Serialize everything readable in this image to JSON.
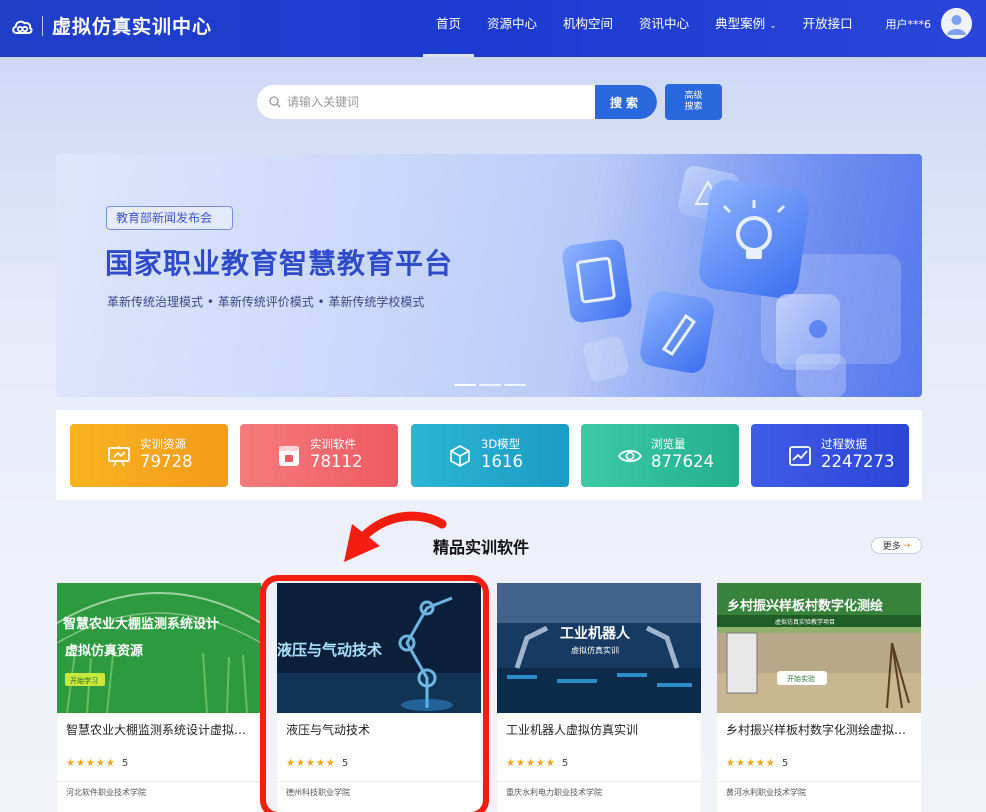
{
  "header": {
    "logo_text": "虚拟仿真实训中心",
    "nav": [
      {
        "label": "首页",
        "active": true
      },
      {
        "label": "资源中心"
      },
      {
        "label": "机构空间"
      },
      {
        "label": "资讯中心"
      },
      {
        "label": "典型案例",
        "dropdown": true
      },
      {
        "label": "开放接口"
      }
    ],
    "user_name": "用户***6"
  },
  "search": {
    "placeholder": "请输入关键词",
    "button": "搜索",
    "advanced_line1": "高级",
    "advanced_line2": "搜索"
  },
  "banner": {
    "tag": "教育部新闻发布会",
    "title": "国家职业教育智慧教育平台",
    "subtitle": "革新传统治理模式 • 革新传统评价模式 • 革新传统学校模式",
    "slides": 3,
    "active_slide": 0
  },
  "stats": [
    {
      "label": "实训资源",
      "value": "79728",
      "icon": "presentation-icon",
      "color_from": "#f7b21f",
      "color_to": "#f59a1a"
    },
    {
      "label": "实训软件",
      "value": "78112",
      "icon": "software-icon",
      "color_from": "#f4787a",
      "color_to": "#ee5a63"
    },
    {
      "label": "3D模型",
      "value": "1616",
      "icon": "cube-icon",
      "color_from": "#2bb5d2",
      "color_to": "#1a9bc4"
    },
    {
      "label": "浏览量",
      "value": "877624",
      "icon": "eye-icon",
      "color_from": "#3ccaa7",
      "color_to": "#22b08c"
    },
    {
      "label": "过程数据",
      "value": "2247273",
      "icon": "chart-icon",
      "color_from": "#3f5ce6",
      "color_to": "#2b45d6"
    }
  ],
  "section": {
    "title": "精品实训软件",
    "more": "更多"
  },
  "cards": [
    {
      "title": "智慧农业大棚监测系统设计虚拟…",
      "rating": "5",
      "school": "河北软件职业技术学院",
      "image_text1": "智慧农业大棚监测系统设计",
      "image_text2": "虚拟仿真资源",
      "image_button": "开始学习"
    },
    {
      "title": "液压与气动技术",
      "rating": "5",
      "school": "德州科技职业学院",
      "image_text1": "液压与气动技术"
    },
    {
      "title": "工业机器人虚拟仿真实训",
      "rating": "5",
      "school": "重庆水利电力职业技术学院",
      "image_text1": "工业机器人",
      "image_text2": "虚拟仿真实训"
    },
    {
      "title": "乡村振兴样板村数字化测绘虚拟…",
      "rating": "5",
      "school": "黄河水利职业技术学院",
      "image_text1": "乡村振兴样板村数字化测绘",
      "image_text2": "虚拟仿真实验教学项目",
      "image_button": "开始实验"
    }
  ]
}
